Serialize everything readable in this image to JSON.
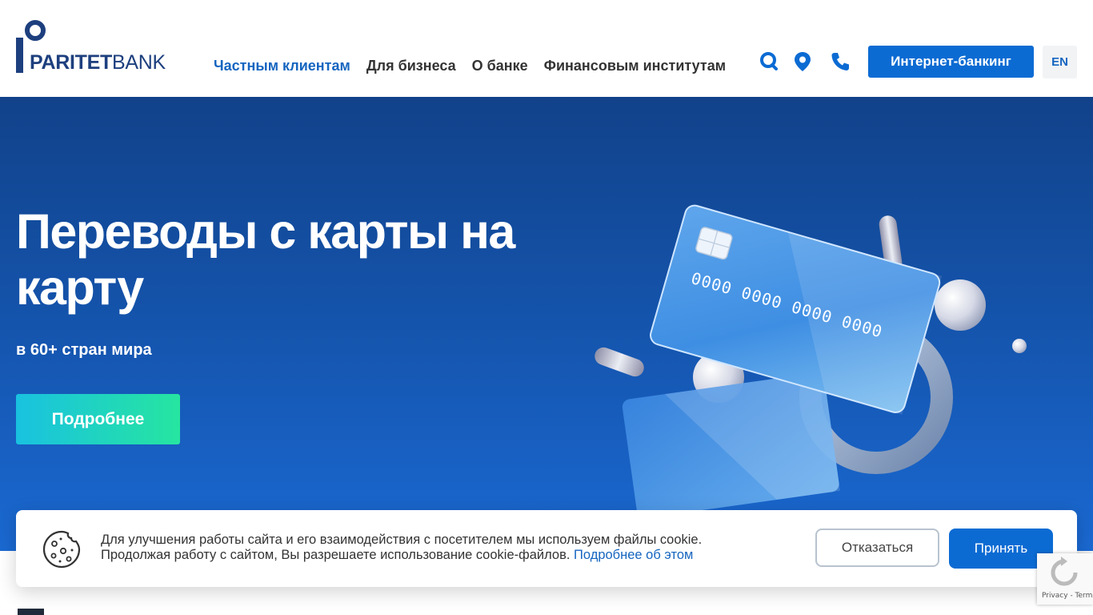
{
  "header": {
    "logo": {
      "text_bold": "PARITET",
      "text_regular": "BANK"
    },
    "nav": [
      {
        "label": "Частным клиентам",
        "active": true
      },
      {
        "label": "Для бизнеса",
        "active": false
      },
      {
        "label": "О банке",
        "active": false
      },
      {
        "label": "Финансовым институтам",
        "active": false
      }
    ],
    "icons": [
      "search-icon",
      "location-pin-icon",
      "phone-icon"
    ],
    "internet_banking_label": "Интернет-банкинг",
    "lang_label": "EN"
  },
  "hero": {
    "title": "Переводы с карты на карту",
    "subtitle": "в 60+ стран мира",
    "button_label": "Подробнее",
    "card_number": "0000 0000 0000 0000"
  },
  "cookie": {
    "text_line1": "Для улучшения работы сайта и его взаимодействия с посетителем мы используем файлы cookie.",
    "text_line2": "Продолжая работу с сайтом, Вы разрешаете использование cookie-файлов.",
    "link_label": "Подробнее об этом",
    "decline_label": "Отказаться",
    "accept_label": "Принять"
  },
  "recaptcha": {
    "terms": "Privacy - Terms"
  },
  "colors": {
    "brand_blue": "#0b6bd3",
    "logo_navy": "#1d3f7e",
    "hero_top": "#11428a",
    "hero_bottom": "#1a69d2",
    "cta_gradient_start": "#19c2e0",
    "cta_gradient_end": "#26e5a0"
  }
}
